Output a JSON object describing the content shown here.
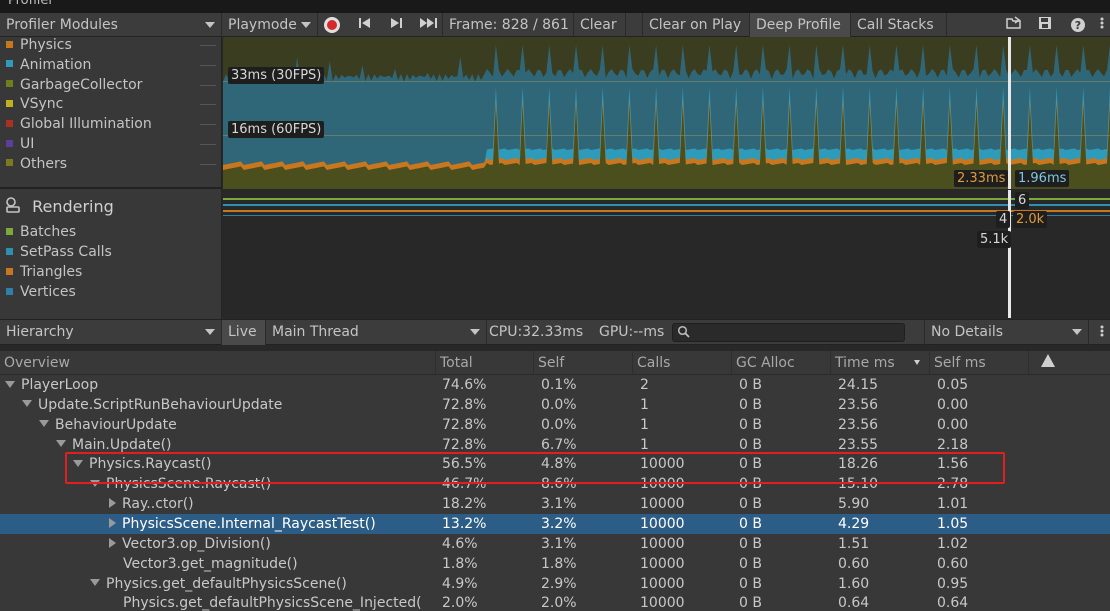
{
  "window": {
    "title": "Profiler"
  },
  "toolbar": {
    "modules_label": "Profiler Modules",
    "playmode_label": "Playmode",
    "frame_label": "Frame: 828 / 861",
    "clear_label": "Clear",
    "clear_on_play_label": "Clear on Play",
    "deep_profile_label": "Deep Profile",
    "call_stacks_label": "Call Stacks"
  },
  "modules": {
    "cpu_items": [
      {
        "label": "Physics",
        "color": "#c8771e"
      },
      {
        "label": "Animation",
        "color": "#2f9bbb"
      },
      {
        "label": "GarbageCollector",
        "color": "#6f7f1e"
      },
      {
        "label": "VSync",
        "color": "#c2b11f"
      },
      {
        "label": "Global Illumination",
        "color": "#a8321f"
      },
      {
        "label": "UI",
        "color": "#5b3f9c"
      },
      {
        "label": "Others",
        "color": "#7b7a1e"
      }
    ],
    "rendering_title": "Rendering",
    "rendering_items": [
      {
        "label": "Batches",
        "color": "#7fa83a"
      },
      {
        "label": "SetPass Calls",
        "color": "#2f8fb0"
      },
      {
        "label": "Triangles",
        "color": "#c8771e"
      },
      {
        "label": "Vertices",
        "color": "#2f7fa8"
      }
    ]
  },
  "graph": {
    "line_30fps": "33ms (30FPS)",
    "line_60fps": "16ms (60FPS)",
    "tooltip_a": "2.33ms",
    "tooltip_b": "1.96ms",
    "render_a": "6",
    "render_b": "4",
    "render_c": "2.0k",
    "render_d": "5.1k"
  },
  "hierarchy_bar": {
    "view_label": "Hierarchy",
    "live_label": "Live",
    "thread_label": "Main Thread",
    "cpu_label": "CPU:32.33ms",
    "gpu_label": "GPU:--ms",
    "search_placeholder": "",
    "details_label": "No Details"
  },
  "table": {
    "headers": [
      "Overview",
      "Total",
      "Self",
      "Calls",
      "GC Alloc",
      "Time ms",
      "Self ms"
    ],
    "rows": [
      {
        "name": "PlayerLoop",
        "total": "74.6%",
        "self": "0.1%",
        "calls": "2",
        "gc": "0 B",
        "time": "24.15",
        "selfms": "0.05"
      },
      {
        "name": "Update.ScriptRunBehaviourUpdate",
        "total": "72.8%",
        "self": "0.0%",
        "calls": "1",
        "gc": "0 B",
        "time": "23.56",
        "selfms": "0.00"
      },
      {
        "name": "BehaviourUpdate",
        "total": "72.8%",
        "self": "0.0%",
        "calls": "1",
        "gc": "0 B",
        "time": "23.56",
        "selfms": "0.00"
      },
      {
        "name": "Main.Update()",
        "total": "72.8%",
        "self": "6.7%",
        "calls": "1",
        "gc": "0 B",
        "time": "23.55",
        "selfms": "2.18"
      },
      {
        "name": "Physics.Raycast()",
        "total": "56.5%",
        "self": "4.8%",
        "calls": "10000",
        "gc": "0 B",
        "time": "18.26",
        "selfms": "1.56"
      },
      {
        "name": "PhysicsScene.Raycast()",
        "total": "46.7%",
        "self": "8.6%",
        "calls": "10000",
        "gc": "0 B",
        "time": "15.10",
        "selfms": "2.78"
      },
      {
        "name": "Ray..ctor()",
        "total": "18.2%",
        "self": "3.1%",
        "calls": "10000",
        "gc": "0 B",
        "time": "5.90",
        "selfms": "1.01"
      },
      {
        "name": "PhysicsScene.Internal_RaycastTest()",
        "total": "13.2%",
        "self": "3.2%",
        "calls": "10000",
        "gc": "0 B",
        "time": "4.29",
        "selfms": "1.05"
      },
      {
        "name": "Vector3.op_Division()",
        "total": "4.6%",
        "self": "3.1%",
        "calls": "10000",
        "gc": "0 B",
        "time": "1.51",
        "selfms": "1.02"
      },
      {
        "name": "Vector3.get_magnitude()",
        "total": "1.8%",
        "self": "1.8%",
        "calls": "10000",
        "gc": "0 B",
        "time": "0.60",
        "selfms": "0.60"
      },
      {
        "name": "Physics.get_defaultPhysicsScene()",
        "total": "4.9%",
        "self": "2.9%",
        "calls": "10000",
        "gc": "0 B",
        "time": "1.60",
        "selfms": "0.95"
      },
      {
        "name": "Physics.get_defaultPhysicsScene_Injected(",
        "total": "2.0%",
        "self": "2.0%",
        "calls": "10000",
        "gc": "0 B",
        "time": "0.64",
        "selfms": "0.64"
      }
    ]
  }
}
